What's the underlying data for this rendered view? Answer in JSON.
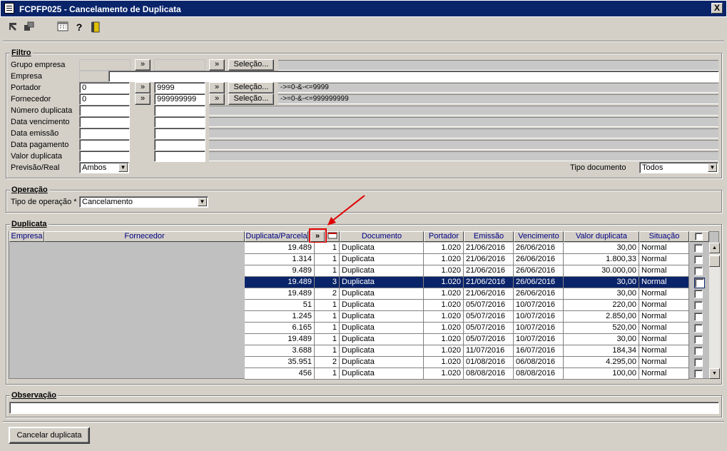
{
  "window": {
    "title": "FCPFP025 - Cancelamento de Duplicata",
    "close": "X"
  },
  "toolbar": {
    "icons": [
      "export-icon",
      "duplicate-icon",
      "calendar-icon",
      "help-icon",
      "exit-door-icon"
    ]
  },
  "filtro": {
    "legend": "Filtro",
    "grupo_empresa": {
      "label": "Grupo empresa",
      "btn": "»",
      "btn2": "»",
      "selecao": "Seleção..."
    },
    "empresa": {
      "label": "Empresa"
    },
    "portador": {
      "label": "Portador",
      "from": "0",
      "to": "9999",
      "btn": "»",
      "btn2": "»",
      "selecao": "Seleção...",
      "expr": "->=0-&-<=9999"
    },
    "fornecedor": {
      "label": "Fornecedor",
      "from": "0",
      "to": "999999999",
      "btn": "»",
      "btn2": "»",
      "selecao": "Seleção...",
      "expr": "->=0-&-<=999999999"
    },
    "numero_duplicata": {
      "label": "Número duplicata"
    },
    "data_vencimento": {
      "label": "Data vencimento"
    },
    "data_emissao": {
      "label": "Data emissão"
    },
    "data_pagamento": {
      "label": "Data pagamento"
    },
    "valor_duplicata": {
      "label": "Valor duplicata"
    },
    "previsao_real": {
      "label": "Previsão/Real",
      "value": "Ambos"
    },
    "tipo_documento": {
      "label": "Tipo documento",
      "value": "Todos"
    }
  },
  "operacao": {
    "legend": "Operação",
    "tipo_label": "Tipo de operação *",
    "tipo_value": "Cancelamento"
  },
  "duplicata": {
    "legend": "Duplicata",
    "columns": {
      "empresa": "Empresa",
      "fornecedor": "Fornecedor",
      "duplicata_parcela": "Duplicata/Parcela",
      "expand_btn": "»",
      "documento": "Documento",
      "portador": "Portador",
      "emissao": "Emissão",
      "vencimento": "Vencimento",
      "valor": "Valor duplicata",
      "situacao": "Situação"
    },
    "rows": [
      {
        "dup": "19.489",
        "parc": "1",
        "doc": "Duplicata",
        "port": "1.020",
        "emis": "21/06/2016",
        "venc": "26/06/2016",
        "valor": "30,00",
        "sit": "Normal"
      },
      {
        "dup": "1.314",
        "parc": "1",
        "doc": "Duplicata",
        "port": "1.020",
        "emis": "21/06/2016",
        "venc": "26/06/2016",
        "valor": "1.800,33",
        "sit": "Normal"
      },
      {
        "dup": "9.489",
        "parc": "1",
        "doc": "Duplicata",
        "port": "1.020",
        "emis": "21/06/2016",
        "venc": "26/06/2016",
        "valor": "30.000,00",
        "sit": "Normal"
      },
      {
        "dup": "19.489",
        "parc": "3",
        "doc": "Duplicata",
        "port": "1.020",
        "emis": "21/06/2016",
        "venc": "26/06/2016",
        "valor": "30,00",
        "sit": "Normal",
        "selected": true
      },
      {
        "dup": "19.489",
        "parc": "2",
        "doc": "Duplicata",
        "port": "1.020",
        "emis": "21/06/2016",
        "venc": "26/06/2016",
        "valor": "30,00",
        "sit": "Normal"
      },
      {
        "dup": "51",
        "parc": "1",
        "doc": "Duplicata",
        "port": "1.020",
        "emis": "05/07/2016",
        "venc": "10/07/2016",
        "valor": "220,00",
        "sit": "Normal"
      },
      {
        "dup": "1.245",
        "parc": "1",
        "doc": "Duplicata",
        "port": "1.020",
        "emis": "05/07/2016",
        "venc": "10/07/2016",
        "valor": "2.850,00",
        "sit": "Normal"
      },
      {
        "dup": "6.165",
        "parc": "1",
        "doc": "Duplicata",
        "port": "1.020",
        "emis": "05/07/2016",
        "venc": "10/07/2016",
        "valor": "520,00",
        "sit": "Normal"
      },
      {
        "dup": "19.489",
        "parc": "1",
        "doc": "Duplicata",
        "port": "1.020",
        "emis": "05/07/2016",
        "venc": "10/07/2016",
        "valor": "30,00",
        "sit": "Normal"
      },
      {
        "dup": "3.688",
        "parc": "1",
        "doc": "Duplicata",
        "port": "1.020",
        "emis": "11/07/2016",
        "venc": "16/07/2016",
        "valor": "184,34",
        "sit": "Normal"
      },
      {
        "dup": "35.951",
        "parc": "2",
        "doc": "Duplicata",
        "port": "1.020",
        "emis": "01/08/2016",
        "venc": "06/08/2016",
        "valor": "4.295,00",
        "sit": "Normal"
      },
      {
        "dup": "456",
        "parc": "1",
        "doc": "Duplicata",
        "port": "1.020",
        "emis": "08/08/2016",
        "venc": "08/08/2016",
        "valor": "100,00",
        "sit": "Normal"
      }
    ]
  },
  "observacao": {
    "legend": "Observação",
    "value": ""
  },
  "actions": {
    "cancelar": "Cancelar duplicata"
  },
  "colors": {
    "titlebar": "#0a246a",
    "selection": "#0a246a",
    "header_text": "#000080",
    "highlight": "#e00000"
  }
}
